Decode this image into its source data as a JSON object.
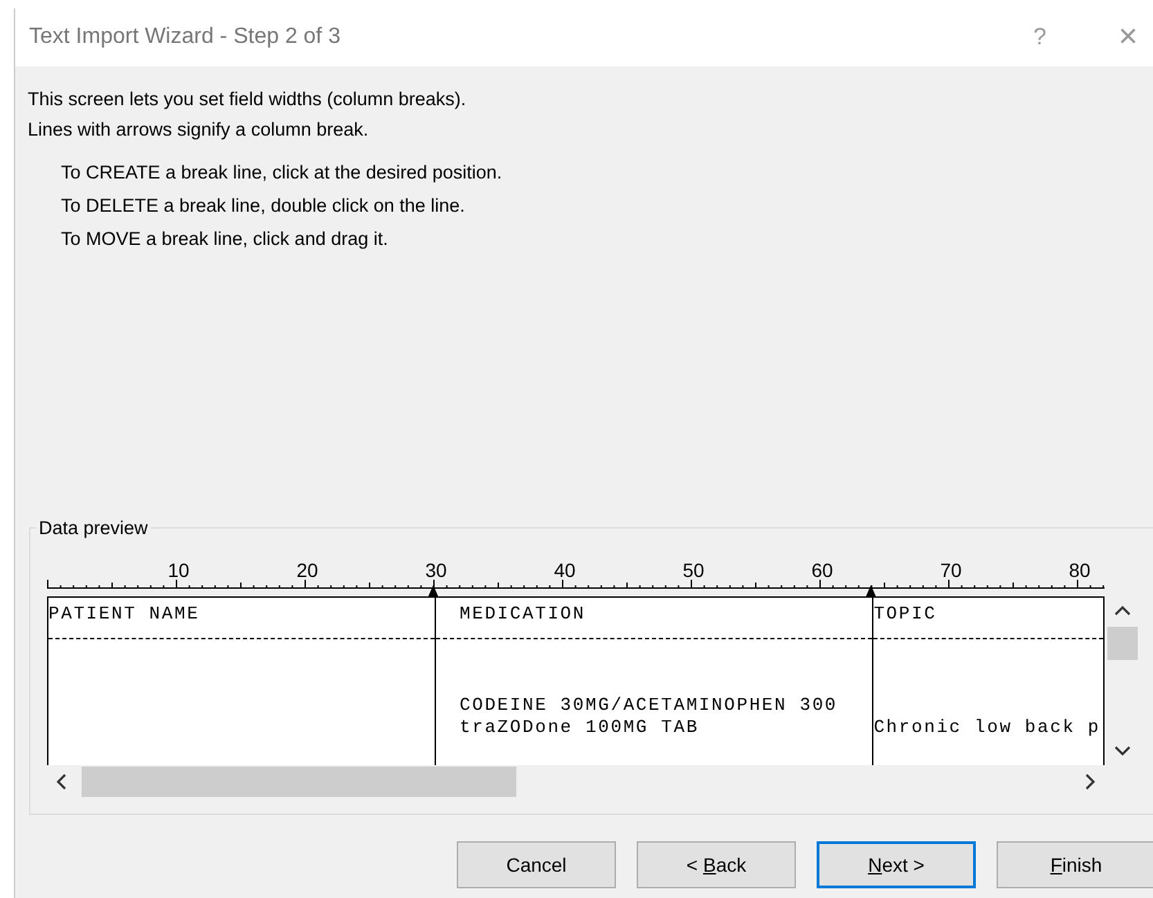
{
  "window": {
    "title": "Text Import Wizard - Step 2 of 3",
    "help": "?",
    "close": "×"
  },
  "intro": [
    "This screen lets you set field widths (column breaks).",
    "Lines with arrows signify a column break."
  ],
  "instructions": [
    "To CREATE a break line, click at the desired position.",
    "To DELETE a break line, double click on the line.",
    "To MOVE a break line, click and drag it."
  ],
  "preview": {
    "title": "Data preview",
    "ruler_labels": [
      "10",
      "20",
      "30",
      "40",
      "50",
      "60",
      "70",
      "80"
    ],
    "columns": [
      {
        "header": "PATIENT NAME"
      },
      {
        "header": "MEDICATION"
      },
      {
        "header": "TOPIC"
      }
    ],
    "rows": [
      {
        "cells": [
          null,
          "CODEINE 30MG/ACETAMINOPHEN 300",
          null
        ]
      },
      {
        "cells": [
          null,
          "traZODone 100MG TAB",
          "Chronic low back p"
        ]
      }
    ]
  },
  "buttons": [
    {
      "before": "Cancel",
      "default": false
    },
    {
      "before": "< ",
      "key": "B",
      "after": "ack",
      "default": false
    },
    {
      "key": "N",
      "after": "ext >",
      "default": true
    },
    {
      "key": "F",
      "after": "inish",
      "default": false
    }
  ]
}
